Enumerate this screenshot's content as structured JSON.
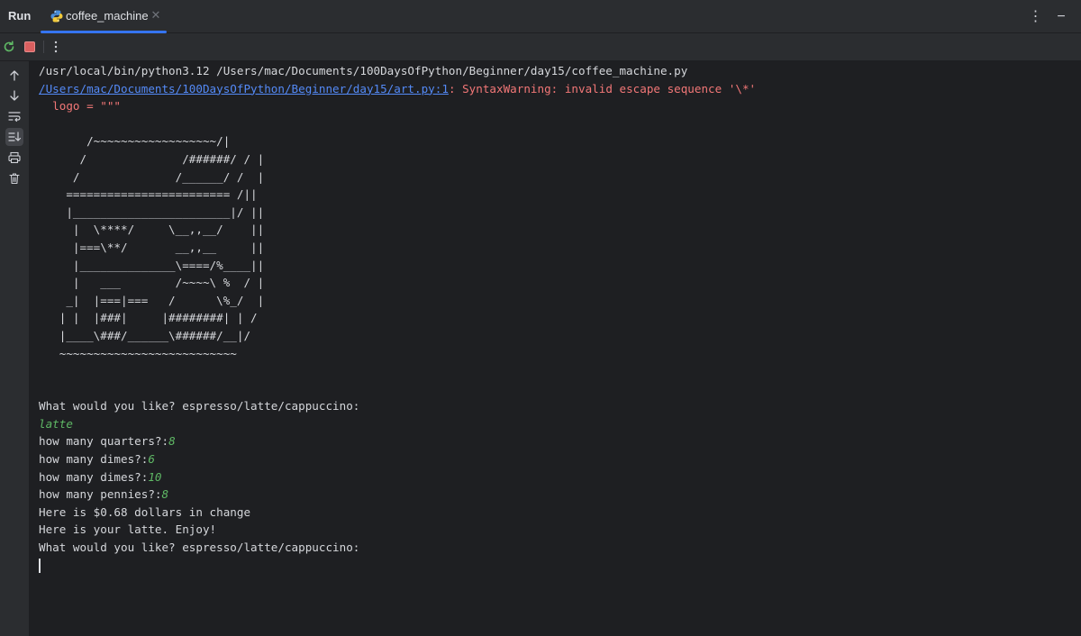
{
  "panel": {
    "title": "Run",
    "tab_label": "coffee_machine"
  },
  "colors": {
    "background": "#1e1f22",
    "panel": "#2b2d30",
    "accent": "#3574f0",
    "error": "#f27777",
    "link": "#548af7",
    "user_input": "#5fb865",
    "stop": "#d95f5f"
  },
  "icons": {
    "rerun": "rerun-icon",
    "stop": "stop-icon",
    "more": "more-vertical-icon",
    "up": "arrow-up-icon",
    "down": "arrow-down-icon",
    "soft_wrap": "soft-wrap-icon",
    "scroll_end": "scroll-to-end-icon",
    "print": "print-icon",
    "trash": "trash-icon"
  },
  "console": {
    "command": "/usr/local/bin/python3.12 /Users/mac/Documents/100DaysOfPython/Beginner/day15/coffee_machine.py",
    "warning_link": "/Users/mac/Documents/100DaysOfPython/Beginner/day15/art.py:1",
    "warning_text": ": SyntaxWarning: invalid escape sequence '\\*'",
    "warning_source": "  logo = \"\"\"",
    "ascii_art": [
      "",
      "       /~~~~~~~~~~~~~~~~~~/|",
      "      /              /######/ / |",
      "     /              /______/ /  |",
      "    ======================== /||",
      "    |_______________________|/ ||",
      "     |  \\****/     \\__,,__/    ||",
      "     |===\\**/       __,,__     ||",
      "     |______________\\====/%____||",
      "     |   ___        /~~~~\\ %  / |",
      "    _|  |===|===   /      \\%_/  |",
      "   | |  |###|     |########| | /",
      "   |____\\###/______\\######/__|/",
      "   ~~~~~~~~~~~~~~~~~~~~~~~~~~",
      "",
      ""
    ],
    "prompt": "What would you like? espresso/latte/cappuccino:",
    "choice": "latte",
    "q_quarters": "how many quarters?:",
    "a_quarters": "8",
    "q_dimes_1": "how many dimes?:",
    "a_dimes_1": "6",
    "q_dimes_2": "how many dimes?:",
    "a_dimes_2": "10",
    "q_pennies": "how many pennies?:",
    "a_pennies": "8",
    "change": "Here is $0.68 dollars in change",
    "serve": "Here is your latte. Enjoy!",
    "prompt_again": "What would you like? espresso/latte/cappuccino:"
  }
}
